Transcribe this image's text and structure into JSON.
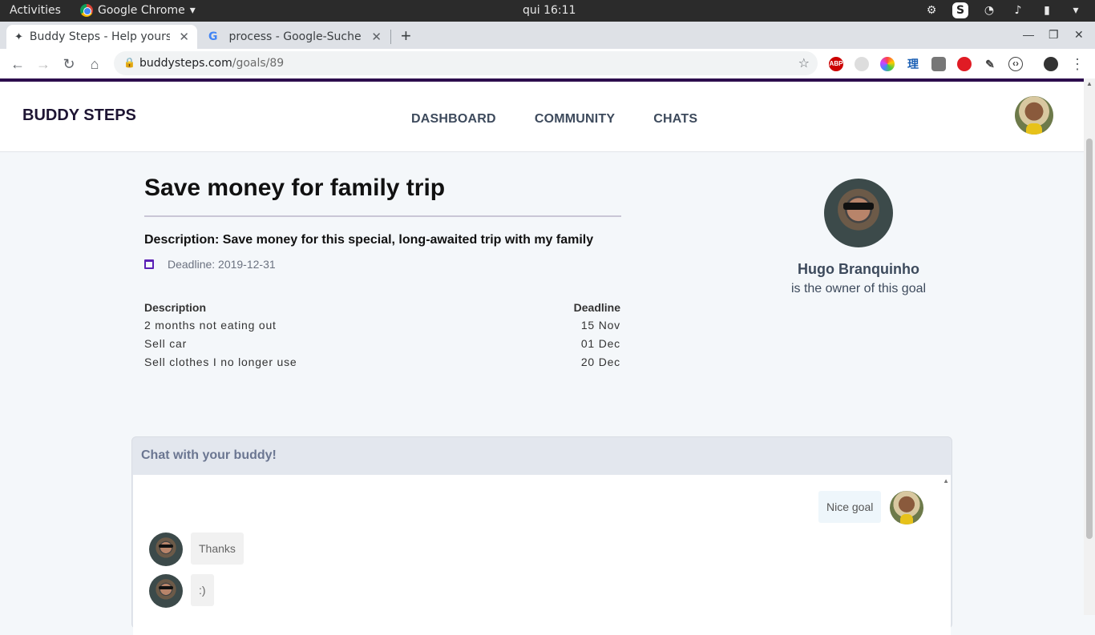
{
  "os": {
    "activities": "Activities",
    "app_name": "Google Chrome",
    "clock": "qui 16:11"
  },
  "browser": {
    "tabs": [
      {
        "title": "Buddy Steps - Help yourse",
        "active": true
      },
      {
        "title": "process - Google-Suche",
        "active": false
      }
    ],
    "url_host": "buddysteps.com",
    "url_path": "/goals/89"
  },
  "site": {
    "brand": "BUDDY STEPS",
    "nav": [
      "DASHBOARD",
      "COMMUNITY",
      "CHATS"
    ]
  },
  "goal": {
    "title": "Save money for family trip",
    "description": "Description: Save money for this special, long-awaited trip with my family",
    "deadline": "Deadline: 2019-12-31",
    "table_headers": [
      "Description",
      "Deadline"
    ],
    "steps": [
      {
        "description": "2 months not eating out",
        "deadline": "15 Nov"
      },
      {
        "description": "Sell car",
        "deadline": "01 Dec"
      },
      {
        "description": "Sell clothes I no longer use",
        "deadline": "20 Dec"
      }
    ]
  },
  "owner": {
    "name": "Hugo Branquinho",
    "subtitle": "is the owner of this goal"
  },
  "chat": {
    "title": "Chat with your buddy!",
    "messages": [
      {
        "text": "Nice goal",
        "from": "me"
      },
      {
        "text": "Thanks",
        "from": "buddy"
      },
      {
        "text": ":)",
        "from": "buddy"
      }
    ]
  },
  "colors": {
    "brand_dark": "#1e1533",
    "accent_purple": "#2d0d4d",
    "nav_text": "#3d4a5c",
    "page_bg": "#f4f7fa"
  }
}
